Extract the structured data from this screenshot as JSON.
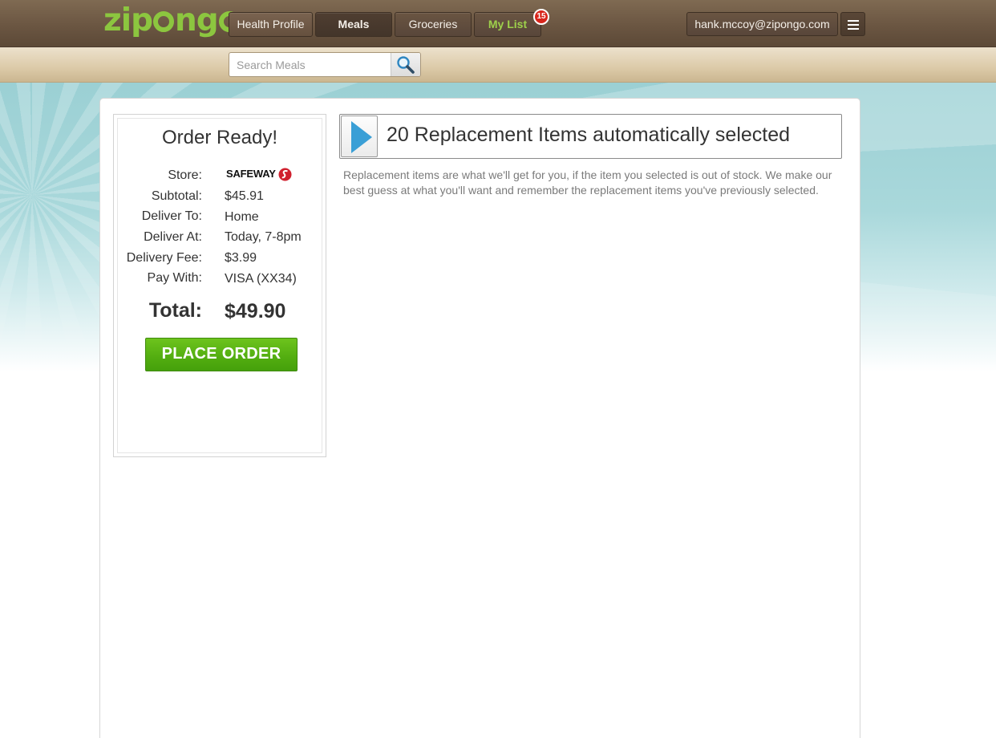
{
  "header": {
    "logo_text": "zipongo",
    "nav_tabs": [
      {
        "label": "Health Profile"
      },
      {
        "label": "Meals"
      },
      {
        "label": "Groceries"
      },
      {
        "label": "My List",
        "badge": "15"
      }
    ],
    "account_email": "hank.mccoy@zipongo.com",
    "menu_icon": "hamburger-menu-icon"
  },
  "search": {
    "placeholder": "Search Meals",
    "value": "",
    "icon": "search-icon"
  },
  "order": {
    "title": "Order Ready!",
    "store_label": "Store:",
    "store_value": "SAFEWAY",
    "subtotal_label": "Subtotal:",
    "subtotal_value": "$45.91",
    "deliver_to_label": "Deliver To:",
    "deliver_to_value": "Home",
    "deliver_at_label": "Deliver At:",
    "deliver_at_value": "Today, 7-8pm",
    "delivery_fee_label": "Delivery Fee:",
    "delivery_fee_value": "$3.99",
    "pay_with_label": "Pay With:",
    "pay_with_value": "VISA (XX34)",
    "total_label": "Total:",
    "total_value": "$49.90",
    "place_order_label": "PLACE ORDER"
  },
  "replacements": {
    "heading": "20 Replacement Items automatically selected",
    "description": "Replacement items are what we'll get for you, if the item you selected is out of stock. We make our best guess at what you'll want and remember the replacement items you've previously selected.",
    "expand_icon": "play-arrow-icon"
  },
  "colors": {
    "brand_green": "#8cc63f",
    "header_brown": "#6b5642",
    "button_green": "#52ad10",
    "badge_red": "#d8261c",
    "arrow_blue": "#3a9fd6",
    "safeway_red": "#d0202e",
    "background_teal": "#9bd0d4"
  }
}
